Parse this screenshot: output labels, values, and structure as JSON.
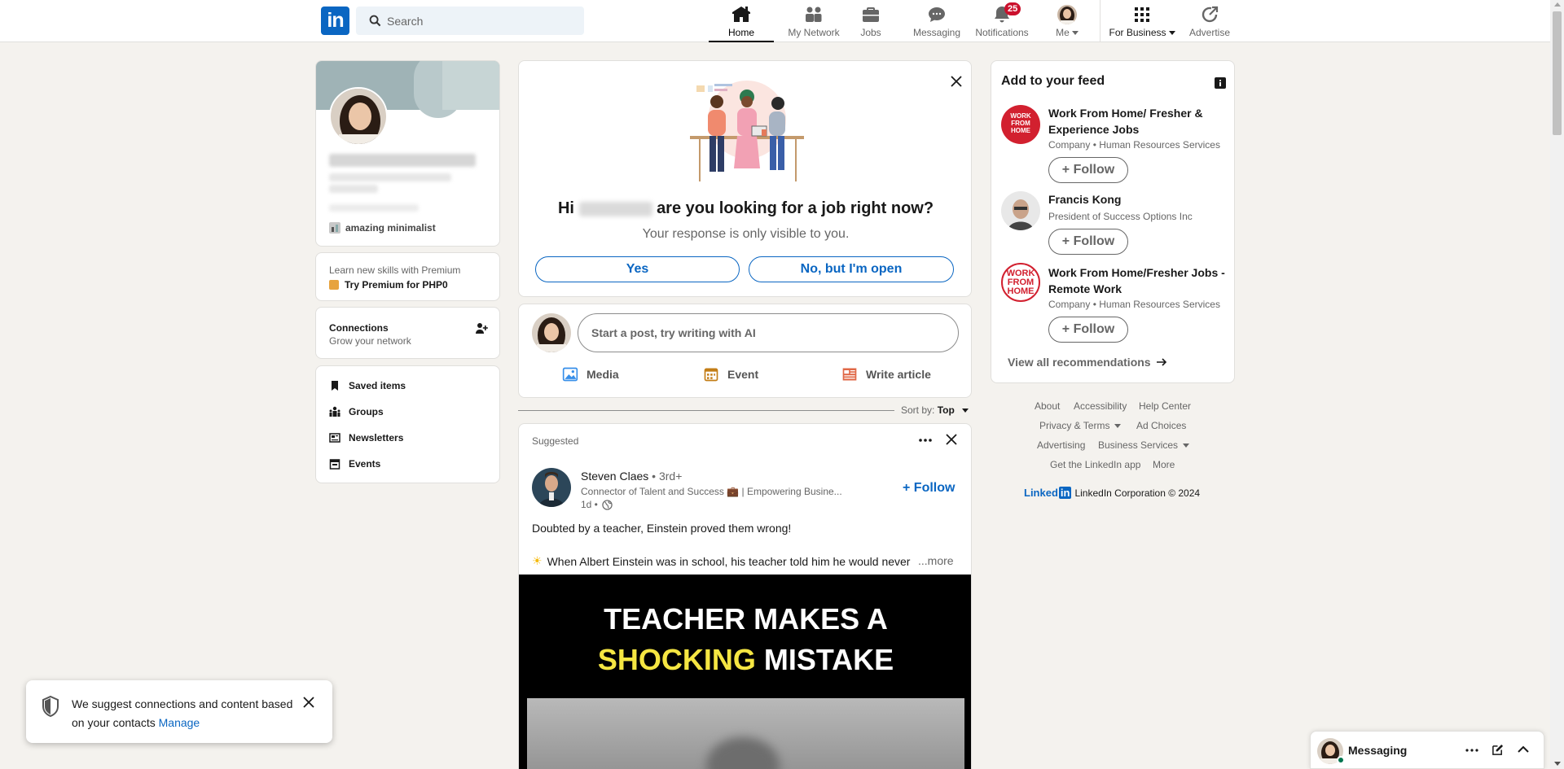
{
  "header": {
    "logo": "in",
    "search_placeholder": "Search",
    "nav": [
      {
        "label": "Home",
        "icon": "home-icon",
        "active": true
      },
      {
        "label": "My Network",
        "icon": "network-icon"
      },
      {
        "label": "Jobs",
        "icon": "briefcase-icon"
      },
      {
        "label": "Messaging",
        "icon": "chat-icon"
      },
      {
        "label": "Notifications",
        "icon": "bell-icon",
        "badge": "25"
      },
      {
        "label": "Me",
        "icon": "avatar"
      },
      {
        "label": "For Business",
        "icon": "grid-icon"
      },
      {
        "label": "Advertise",
        "icon": "advertise-icon"
      }
    ]
  },
  "left": {
    "profile": {
      "group_label": "amazing minimalist"
    },
    "premium": {
      "line1": "Learn new skills with Premium",
      "line2": "Try Premium for PHP0"
    },
    "connections": {
      "title": "Connections",
      "subtitle": "Grow your network"
    },
    "links": [
      "Saved items",
      "Groups",
      "Newsletters",
      "Events"
    ]
  },
  "job_prompt": {
    "greeting_prefix": "Hi",
    "question": "are you looking for a job right now?",
    "note": "Your response is only visible to you.",
    "yes": "Yes",
    "no": "No, but I'm open"
  },
  "composer": {
    "placeholder": "Start a post, try writing with AI",
    "actions": [
      "Media",
      "Event",
      "Write article"
    ]
  },
  "sort": {
    "label": "Sort by:",
    "value": "Top"
  },
  "post": {
    "tag": "Suggested",
    "author": "Steven Claes",
    "degree": "• 3rd+",
    "headline": "Connector of Talent and Success 💼 | Empowering Busine...",
    "time": "1d •",
    "follow": "+ Follow",
    "line1": "Doubted by a teacher, Einstein proved them wrong!",
    "line2": "When Albert Einstein was in school, his teacher told him he would never",
    "more": "...more",
    "video_line1": "TEACHER MAKES A",
    "video_word_yellow": "SHOCKING",
    "video_word_white": "MISTAKE"
  },
  "feed": {
    "title": "Add to your feed",
    "items": [
      {
        "name": "Work From Home/ Fresher & Experience Jobs",
        "sub": "Company • Human Resources Services",
        "follow": "Follow"
      },
      {
        "name": "Francis Kong",
        "sub": "President of Success Options Inc",
        "follow": "Follow"
      },
      {
        "name": "Work From Home/Fresher Jobs - Remote Work",
        "sub": "Company • Human Resources Services",
        "follow": "Follow"
      }
    ],
    "view_all": "View all recommendations"
  },
  "footer": {
    "row1": [
      "About",
      "Accessibility",
      "Help Center"
    ],
    "row2": [
      "Privacy & Terms",
      "Ad Choices"
    ],
    "row3": [
      "Advertising",
      "Business Services"
    ],
    "row4": [
      "Get the LinkedIn app",
      "More"
    ],
    "brand": "Linked",
    "brand_in": "in",
    "copyright": "LinkedIn Corporation © 2024"
  },
  "toast": {
    "text": "We suggest connections and content based on your contacts",
    "link": "Manage"
  },
  "messaging": {
    "label": "Messaging"
  },
  "colors": {
    "brand": "#0a66c2",
    "badge": "#cb112d",
    "video_yellow": "#f5e642"
  }
}
